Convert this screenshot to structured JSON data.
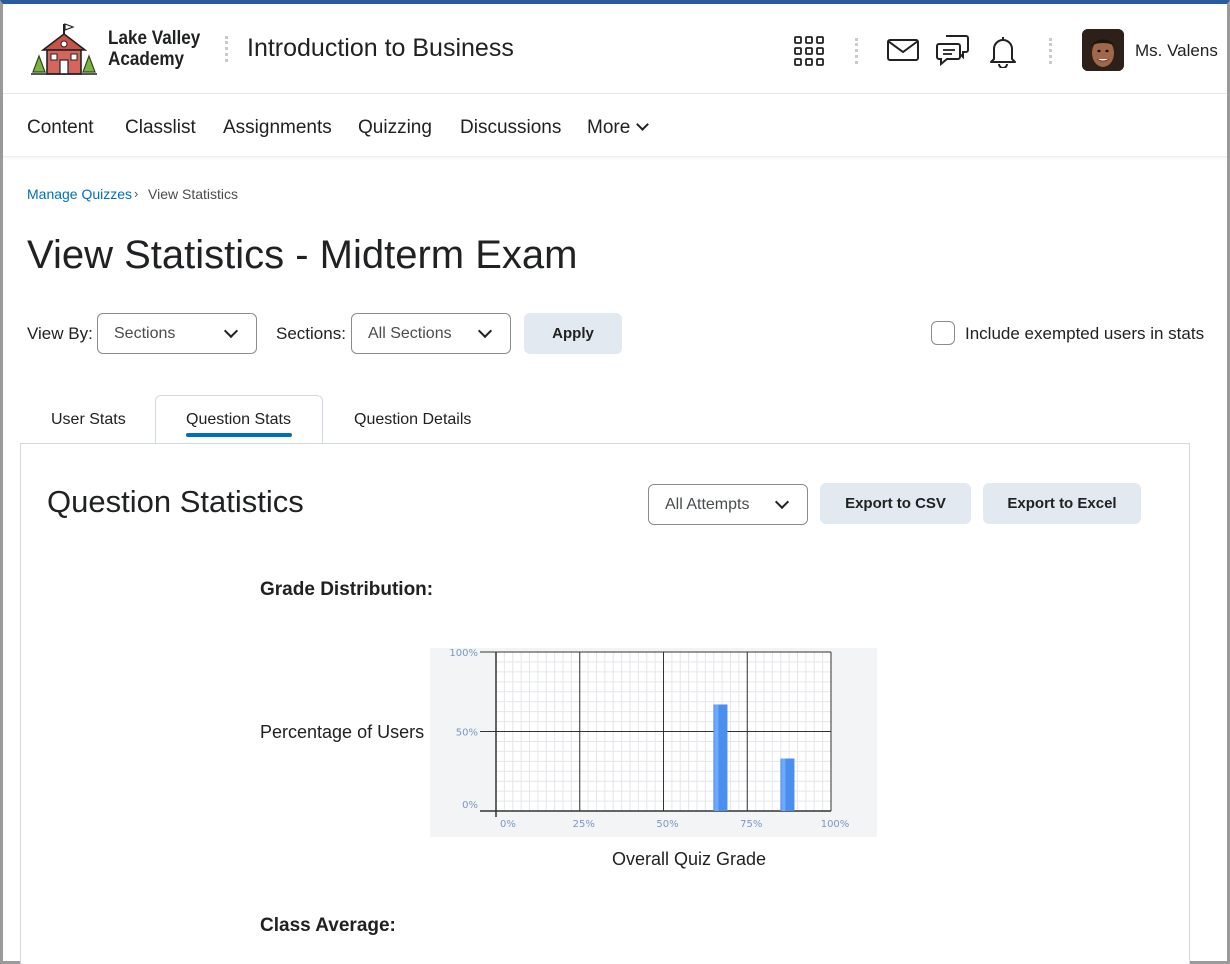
{
  "header": {
    "logo_text_line1": "Lake Valley",
    "logo_text_line2": "Academy",
    "course_title": "Introduction to Business",
    "user_name": "Ms. Valens",
    "icons": [
      "waffle-icon",
      "mail-icon",
      "chat-icon",
      "bell-icon"
    ]
  },
  "nav": {
    "items": [
      "Content",
      "Classlist",
      "Assignments",
      "Quizzing",
      "Discussions",
      "More"
    ]
  },
  "breadcrumb": {
    "link": "Manage Quizzes",
    "current": "View Statistics"
  },
  "page_title": "View Statistics - Midterm Exam",
  "filters": {
    "view_by_label": "View By:",
    "view_by_value": "Sections",
    "sections_label": "Sections:",
    "sections_value": "All Sections",
    "apply_label": "Apply",
    "include_exempted_label": "Include exempted users in stats",
    "include_exempted_checked": false
  },
  "tabs": [
    {
      "label": "User Stats",
      "active": false
    },
    {
      "label": "Question Stats",
      "active": true
    },
    {
      "label": "Question Details",
      "active": false
    }
  ],
  "panel": {
    "title": "Question Statistics",
    "attempts_value": "All Attempts",
    "export_csv_label": "Export to CSV",
    "export_excel_label": "Export to Excel",
    "grade_distribution_heading": "Grade Distribution:",
    "class_average_heading": "Class Average:"
  },
  "chart_data": {
    "type": "bar",
    "xlabel": "Overall Quiz Grade",
    "ylabel": "Percentage of Users",
    "x_ticks": [
      "0%",
      "25%",
      "50%",
      "75%",
      "100%"
    ],
    "y_ticks": [
      "0%",
      "50%",
      "100%"
    ],
    "xlim": [
      0,
      100
    ],
    "ylim": [
      0,
      100
    ],
    "bars": [
      {
        "x": 67,
        "y": 67
      },
      {
        "x": 87,
        "y": 33
      }
    ],
    "grid": true,
    "bar_color": "#4a8ff0"
  },
  "colors": {
    "link": "#006fbf",
    "button_bg": "#e3e9f1",
    "tab_underline": "#006fbf"
  }
}
